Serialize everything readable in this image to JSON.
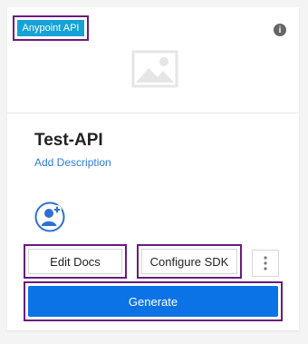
{
  "badge": {
    "label": "Anypoint API",
    "color": "#16a2d7",
    "outline_color": "#6b1b7f"
  },
  "info_icon": "info-icon",
  "thumbnail_icon": "image-placeholder-icon",
  "title": "Test-API",
  "add_description_label": "Add Description",
  "avatar_icon": "add-user-icon",
  "actions": {
    "edit_docs_label": "Edit Docs",
    "configure_sdk_label": "Configure SDK",
    "more_icon": "vertical-ellipsis-icon"
  },
  "generate": {
    "label": "Generate",
    "color": "#0b73e6"
  }
}
